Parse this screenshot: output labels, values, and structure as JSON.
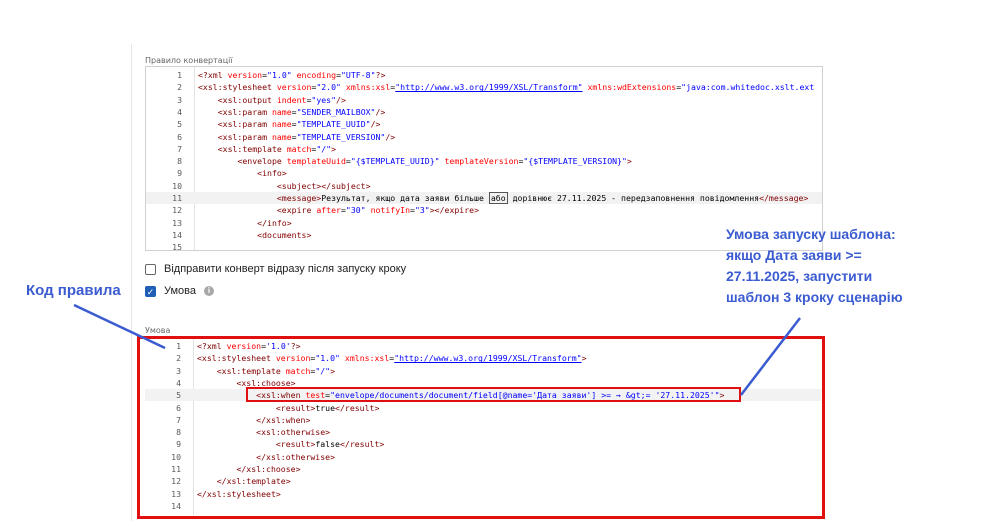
{
  "top_section": {
    "label": "Правило конвертації",
    "lines": [
      {
        "n": "1",
        "parts": [
          [
            "tag",
            "<?xml "
          ],
          [
            "attr",
            "version"
          ],
          [
            "pl",
            "="
          ],
          [
            "val",
            "\"1.0\""
          ],
          [
            "pl",
            " "
          ],
          [
            "attr",
            "encoding"
          ],
          [
            "pl",
            "="
          ],
          [
            "val",
            "\"UTF-8\""
          ],
          [
            "tag",
            "?>"
          ]
        ]
      },
      {
        "n": "2",
        "parts": [
          [
            "tag",
            "<xsl:stylesheet "
          ],
          [
            "attr",
            "version"
          ],
          [
            "pl",
            "="
          ],
          [
            "val",
            "\"2.0\""
          ],
          [
            "pl",
            " "
          ],
          [
            "attr",
            "xmlns:xsl"
          ],
          [
            "pl",
            "="
          ],
          [
            "url",
            "\"http://www.w3.org/1999/XSL/Transform\""
          ],
          [
            "pl",
            " "
          ],
          [
            "attr",
            "xmlns:wdExtensions"
          ],
          [
            "pl",
            "="
          ],
          [
            "val",
            "\"java:com.whitedoc.xslt.ext"
          ]
        ]
      },
      {
        "n": "3",
        "parts": [
          [
            "pl",
            "    "
          ],
          [
            "tag",
            "<xsl:output "
          ],
          [
            "attr",
            "indent"
          ],
          [
            "pl",
            "="
          ],
          [
            "val",
            "\"yes\""
          ],
          [
            "tag",
            "/>"
          ]
        ]
      },
      {
        "n": "4",
        "parts": [
          [
            "pl",
            "    "
          ],
          [
            "tag",
            "<xsl:param "
          ],
          [
            "attr",
            "name"
          ],
          [
            "pl",
            "="
          ],
          [
            "val",
            "\"SENDER_MAILBOX\""
          ],
          [
            "tag",
            "/>"
          ]
        ]
      },
      {
        "n": "5",
        "parts": [
          [
            "pl",
            "    "
          ],
          [
            "tag",
            "<xsl:param "
          ],
          [
            "attr",
            "name"
          ],
          [
            "pl",
            "="
          ],
          [
            "val",
            "\"TEMPLATE_UUID\""
          ],
          [
            "tag",
            "/>"
          ]
        ]
      },
      {
        "n": "6",
        "parts": [
          [
            "pl",
            "    "
          ],
          [
            "tag",
            "<xsl:param "
          ],
          [
            "attr",
            "name"
          ],
          [
            "pl",
            "="
          ],
          [
            "val",
            "\"TEMPLATE_VERSION\""
          ],
          [
            "tag",
            "/>"
          ]
        ]
      },
      {
        "n": "7",
        "parts": [
          [
            "pl",
            "    "
          ],
          [
            "tag",
            "<xsl:template "
          ],
          [
            "attr",
            "match"
          ],
          [
            "pl",
            "="
          ],
          [
            "val",
            "\"/\""
          ],
          [
            "tag",
            ">"
          ]
        ]
      },
      {
        "n": "8",
        "parts": [
          [
            "pl",
            "        "
          ],
          [
            "tag",
            "<envelope "
          ],
          [
            "attr",
            "templateUuid"
          ],
          [
            "pl",
            "="
          ],
          [
            "val",
            "\"{$TEMPLATE_UUID}\""
          ],
          [
            "pl",
            " "
          ],
          [
            "attr",
            "templateVersion"
          ],
          [
            "pl",
            "="
          ],
          [
            "val",
            "\"{$TEMPLATE_VERSION}\""
          ],
          [
            "tag",
            ">"
          ]
        ]
      },
      {
        "n": "9",
        "parts": [
          [
            "pl",
            "            "
          ],
          [
            "tag",
            "<info>"
          ]
        ]
      },
      {
        "n": "10",
        "parts": [
          [
            "pl",
            "                "
          ],
          [
            "tag",
            "<subject></subject>"
          ]
        ]
      },
      {
        "n": "11",
        "parts": [
          [
            "pl",
            "                "
          ],
          [
            "tag",
            "<message>"
          ],
          [
            "pl",
            "Результат, якщо дата заяви більше "
          ],
          [
            "hl",
            "або"
          ],
          [
            "pl",
            " дорівнює 27.11.2025 - передзаповнення повідомлення"
          ],
          [
            "tag",
            "</message>"
          ]
        ]
      },
      {
        "n": "12",
        "parts": [
          [
            "pl",
            "                "
          ],
          [
            "tag",
            "<expire "
          ],
          [
            "attr",
            "after"
          ],
          [
            "pl",
            "="
          ],
          [
            "val",
            "\"30\""
          ],
          [
            "pl",
            " "
          ],
          [
            "attr",
            "notifyIn"
          ],
          [
            "pl",
            "="
          ],
          [
            "val",
            "\"3\""
          ],
          [
            "tag",
            "></expire>"
          ]
        ]
      },
      {
        "n": "13",
        "parts": [
          [
            "pl",
            "            "
          ],
          [
            "tag",
            "</info>"
          ]
        ]
      },
      {
        "n": "14",
        "parts": [
          [
            "pl",
            "            "
          ],
          [
            "tag",
            "<documents>"
          ]
        ]
      },
      {
        "n": "15",
        "parts": []
      }
    ]
  },
  "checkbox_send": {
    "label": "Відправити конверт відразу після запуску кроку",
    "checked": false
  },
  "checkbox_condition": {
    "label": "Умова",
    "checked": true
  },
  "bottom_section": {
    "label": "Умова",
    "lines": [
      {
        "n": "1",
        "parts": [
          [
            "tag",
            "<?xml "
          ],
          [
            "attr",
            "version"
          ],
          [
            "pl",
            "="
          ],
          [
            "val",
            "'1.0'"
          ],
          [
            "tag",
            "?>"
          ]
        ]
      },
      {
        "n": "2",
        "parts": [
          [
            "tag",
            "<xsl:stylesheet "
          ],
          [
            "attr",
            "version"
          ],
          [
            "pl",
            "="
          ],
          [
            "val",
            "\"1.0\""
          ],
          [
            "pl",
            " "
          ],
          [
            "attr",
            "xmlns:xsl"
          ],
          [
            "pl",
            "="
          ],
          [
            "url",
            "\"http://www.w3.org/1999/XSL/Transform\""
          ],
          [
            "tag",
            ">"
          ]
        ]
      },
      {
        "n": "3",
        "parts": [
          [
            "pl",
            "    "
          ],
          [
            "tag",
            "<xsl:template "
          ],
          [
            "attr",
            "match"
          ],
          [
            "pl",
            "="
          ],
          [
            "val",
            "\"/\""
          ],
          [
            "tag",
            ">"
          ]
        ]
      },
      {
        "n": "4",
        "parts": [
          [
            "pl",
            "        "
          ],
          [
            "tag",
            "<xsl:choose>"
          ]
        ]
      },
      {
        "n": "5",
        "parts": [
          [
            "pl",
            "            "
          ],
          [
            "tag",
            "<xsl:when "
          ],
          [
            "attr",
            "test"
          ],
          [
            "pl",
            "="
          ],
          [
            "val",
            "\"envelope/documents/document/field[@name='Дата заяви'] >= → &gt;= '27.11.2025'\""
          ],
          [
            "tag",
            ">"
          ]
        ]
      },
      {
        "n": "6",
        "parts": [
          [
            "pl",
            "                "
          ],
          [
            "tag",
            "<result>"
          ],
          [
            "pl",
            "true"
          ],
          [
            "tag",
            "</result>"
          ]
        ]
      },
      {
        "n": "7",
        "parts": [
          [
            "pl",
            "            "
          ],
          [
            "tag",
            "</xsl:when>"
          ]
        ]
      },
      {
        "n": "8",
        "parts": [
          [
            "pl",
            "            "
          ],
          [
            "tag",
            "<xsl:otherwise>"
          ]
        ]
      },
      {
        "n": "9",
        "parts": [
          [
            "pl",
            "                "
          ],
          [
            "tag",
            "<result>"
          ],
          [
            "pl",
            "false"
          ],
          [
            "tag",
            "</result>"
          ]
        ]
      },
      {
        "n": "10",
        "parts": [
          [
            "pl",
            "            "
          ],
          [
            "tag",
            "</xsl:otherwise>"
          ]
        ]
      },
      {
        "n": "11",
        "parts": [
          [
            "pl",
            "        "
          ],
          [
            "tag",
            "</xsl:choose>"
          ]
        ]
      },
      {
        "n": "12",
        "parts": [
          [
            "pl",
            "    "
          ],
          [
            "tag",
            "</xsl:template>"
          ]
        ]
      },
      {
        "n": "13",
        "parts": [
          [
            "tag",
            "</xsl:stylesheet>"
          ]
        ]
      },
      {
        "n": "14",
        "parts": []
      }
    ]
  },
  "annotations": {
    "left_title": "Код правила",
    "right_lines": [
      "Умова запуску шаблона:",
      "якщо Дата заяви >=",
      "27.11.2025, запустити",
      "шаблон 3 кроку сценарію"
    ],
    "color_blue": "#3b5bd1",
    "color_red": "#e01010"
  }
}
